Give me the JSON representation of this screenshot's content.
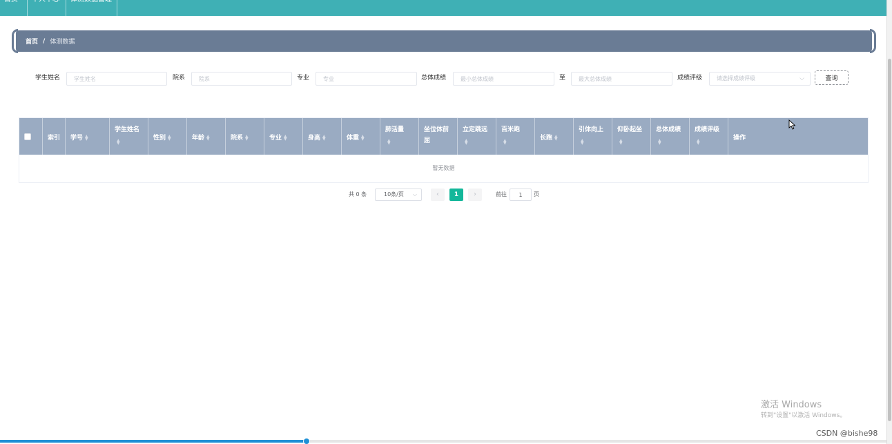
{
  "topnav": {
    "items": [
      "首页",
      "个人中心",
      "体测数据管理"
    ]
  },
  "breadcrumb": {
    "home": "首页",
    "separator": "/",
    "current": "体测数据"
  },
  "search": {
    "student_name_label": "学生姓名",
    "student_name_placeholder": "学生姓名",
    "college_label": "院系",
    "college_placeholder": "院系",
    "major_label": "专业",
    "major_placeholder": "专业",
    "total_score_label": "总体成绩",
    "min_score_placeholder": "最小总体成绩",
    "to_label": "至",
    "max_score_placeholder": "最大总体成绩",
    "grade_label": "成绩评级",
    "grade_select_placeholder": "请选择成绩评级",
    "query_button": "查询"
  },
  "table": {
    "columns": [
      "索引",
      "学号",
      "学生姓名",
      "性别",
      "年龄",
      "院系",
      "专业",
      "身高",
      "体重",
      "肺活量",
      "坐位体前屈",
      "立定跳远",
      "百米跑",
      "长跑",
      "引体向上",
      "仰卧起坐",
      "总体成绩",
      "成绩评级",
      "操作"
    ],
    "empty_text": "暂无数据"
  },
  "pagination": {
    "total_text": "共 0 条",
    "page_size": "10条/页",
    "current_page": "1",
    "goto_label": "前往",
    "goto_value": "1",
    "page_unit": "页"
  },
  "watermark": {
    "windows_title": "激活 Windows",
    "windows_sub": "转到\"设置\"以激活 Windows。",
    "csdn": "CSDN @bishe98"
  },
  "colors": {
    "topnav": "#3fb0b5",
    "breadcrumb_bar": "#6a7c95",
    "table_header": "#9aabc2",
    "active_page": "#13b79a"
  }
}
